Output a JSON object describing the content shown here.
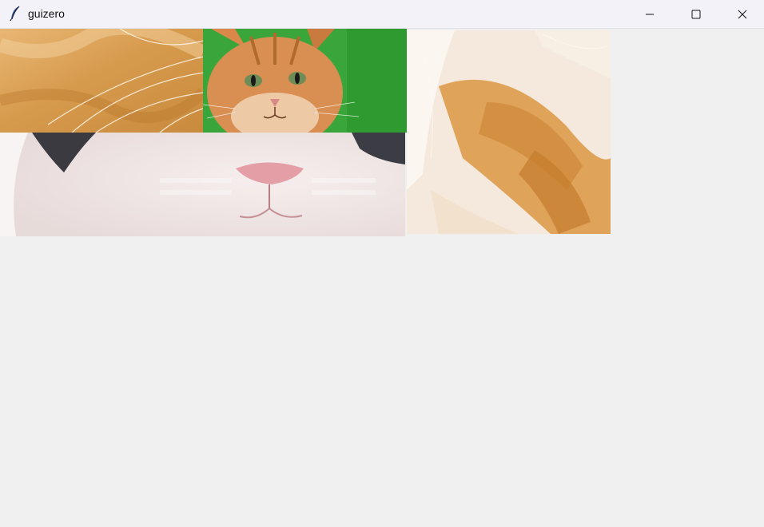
{
  "window": {
    "title": "guizero",
    "app_icon": "feather-icon",
    "controls": {
      "minimize_icon": "minimize-icon",
      "maximize_icon": "maximize-icon",
      "close_icon": "close-icon"
    }
  },
  "tiles": [
    {
      "name": "cat-fur-whiskers"
    },
    {
      "name": "cat-face-green-background"
    },
    {
      "name": "cat-orange-white-fur"
    },
    {
      "name": "cat-white-nose-closeup"
    }
  ],
  "colors": {
    "titlebar": "#f3f2f8",
    "window_bg": "#f0f0f0",
    "green_bg": "#3aa53a",
    "orange_fur": "#d9a060"
  }
}
